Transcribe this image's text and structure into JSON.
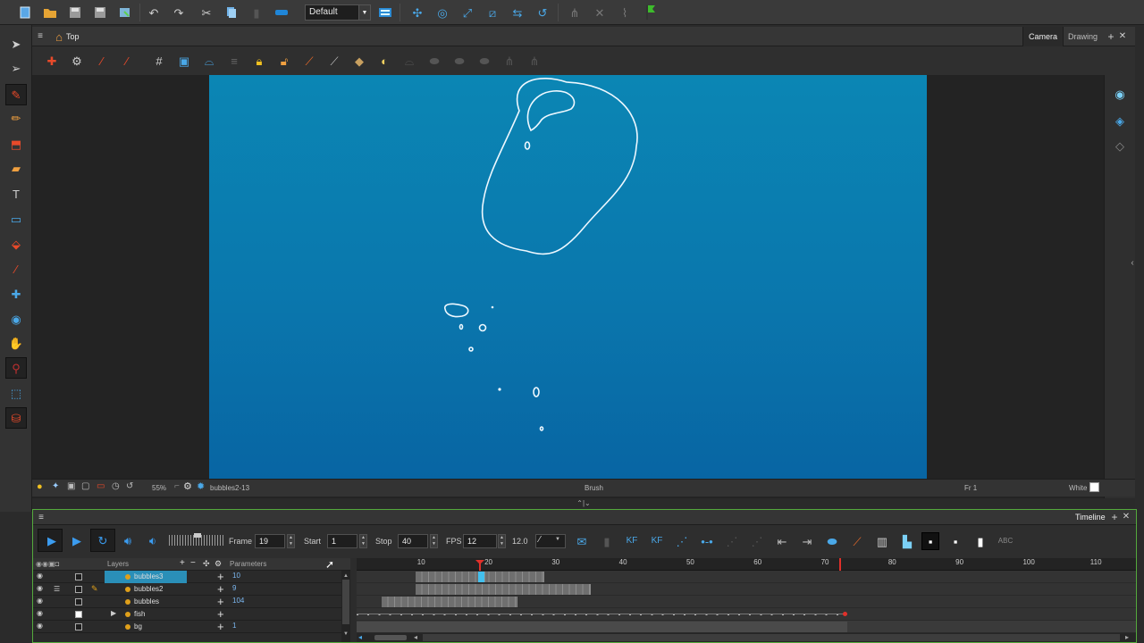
{
  "top_toolbar": {
    "preset": "Default"
  },
  "view_panel": {
    "breadcrumb": "Top",
    "tabs": [
      "Camera",
      "Drawing"
    ],
    "active_tab": "Camera"
  },
  "status_bar": {
    "zoom": "55%",
    "drawing": "bubbles2-13",
    "tool": "Brush",
    "frame": "Fr 1",
    "bg_color_label": "White"
  },
  "timeline": {
    "tab": "Timeline",
    "frame_label": "Frame",
    "frame_value": "19",
    "start_label": "Start",
    "start_value": "1",
    "stop_label": "Stop",
    "stop_value": "40",
    "fps_label": "FPS",
    "fps_value": "12",
    "fps_readout": "12.0",
    "layers_header": "Layers",
    "params_header": "Parameters",
    "ruler_ticks": [
      "10",
      "20",
      "30",
      "40",
      "50",
      "60",
      "70",
      "80",
      "90",
      "100",
      "110"
    ],
    "layers": [
      {
        "name": "bubbles3",
        "param": "10",
        "selected": true
      },
      {
        "name": "bubbles2",
        "param": "9",
        "selected": false
      },
      {
        "name": "bubbles",
        "param": "104",
        "selected": false
      },
      {
        "name": "fish",
        "param": "",
        "selected": false
      },
      {
        "name": "bg",
        "param": "1",
        "selected": false
      }
    ],
    "current_frame": 19,
    "stop_frame": 73
  },
  "colors": {
    "canvas_top": "#0b86b4",
    "canvas_bottom": "#0865a3",
    "selection": "#2a8fb8",
    "timeline_border": "#54a93c",
    "playhead": "#e0302a"
  }
}
